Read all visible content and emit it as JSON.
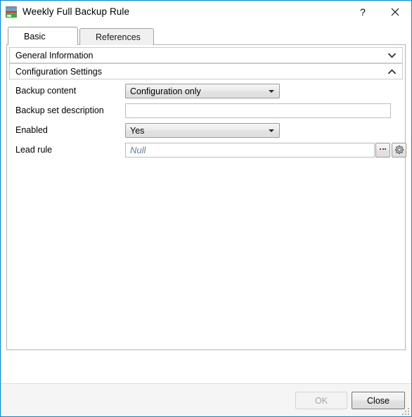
{
  "window": {
    "title": "Weekly Full Backup Rule",
    "icon": "backup-rule-icon",
    "help_label": "?",
    "close_label": "×"
  },
  "tabs": [
    {
      "label": "Basic",
      "selected": true
    },
    {
      "label": "References",
      "selected": false
    }
  ],
  "sections": [
    {
      "label": "General Information",
      "expanded": false,
      "chevron": "chevron-down-icon"
    },
    {
      "label": "Configuration Settings",
      "expanded": true,
      "chevron": "chevron-up-icon"
    }
  ],
  "fields": {
    "backup_content": {
      "label": "Backup content",
      "value": "Configuration only"
    },
    "backup_set_description": {
      "label": "Backup set description",
      "value": "",
      "placeholder": ""
    },
    "enabled": {
      "label": "Enabled",
      "value": "Yes"
    },
    "lead_rule": {
      "label": "Lead rule",
      "value": "Null",
      "browse_label": "...",
      "gear_label": "gear-icon"
    }
  },
  "footer": {
    "ok_label": "OK",
    "close_label": "Close"
  },
  "colors": {
    "window_border": "#1683cf",
    "placeholder_text": "#5c84b1",
    "disabled_text": "#a6a6a6",
    "footer_bg": "#f5f5f5"
  }
}
